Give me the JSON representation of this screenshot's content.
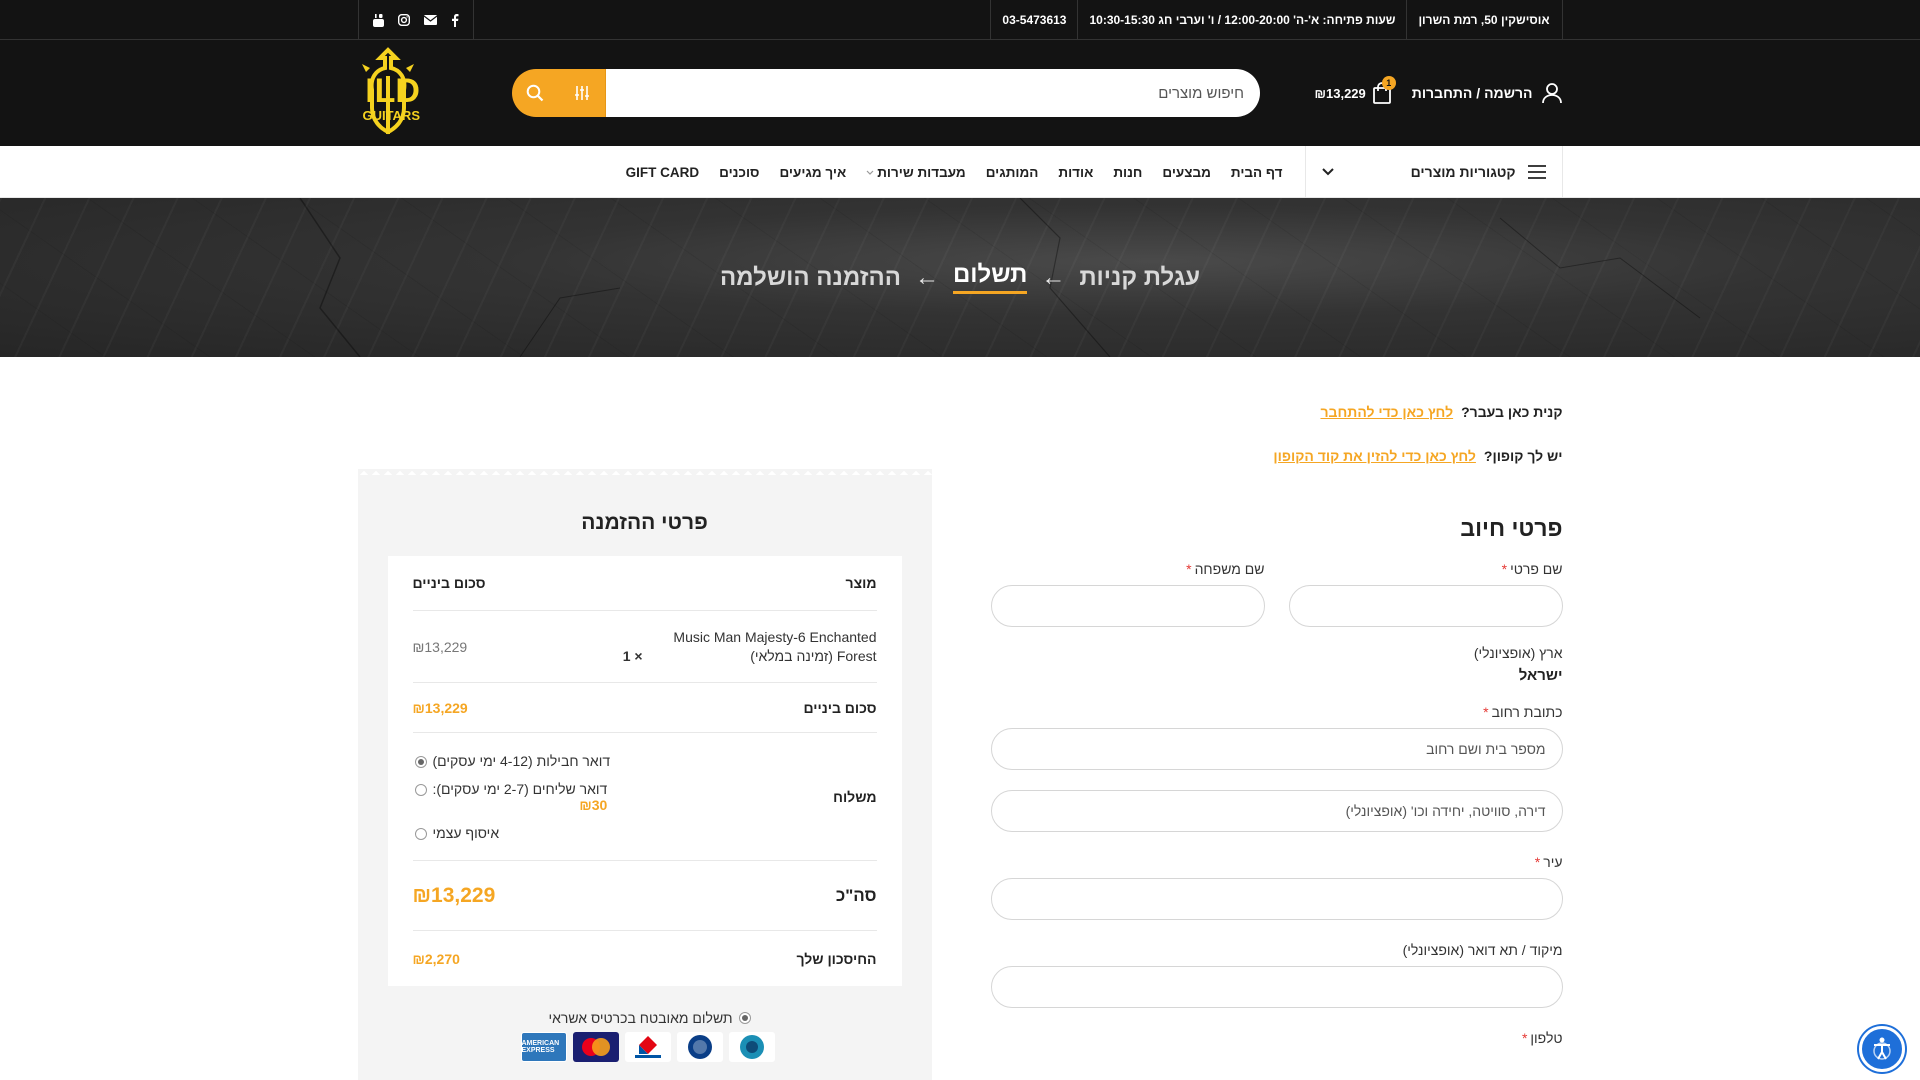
{
  "topbar": {
    "address": "אוסישקין 50, רמת השרון",
    "hours": "שעות פתיחה: א'-ה' 12:00-20:00 / ו' וערבי חג 10:30-15:30",
    "phone": "03-5473613",
    "social": [
      "facebook-icon",
      "envelope-icon",
      "instagram-icon",
      "youtube-icon"
    ]
  },
  "header": {
    "account_label": "הרשמה / התחברות",
    "cart_total": "₪13,229",
    "cart_count": "1",
    "search_placeholder": "חיפוש מוצרים",
    "logo_text_1": "ILD",
    "logo_text_2": "GUITARS"
  },
  "nav": {
    "categories_label": "קטגוריות מוצרים",
    "links": [
      "דף הבית",
      "מבצעים",
      "חנות",
      "אודות",
      "המותגים",
      "מעבדות שירות",
      "איך מגיעים",
      "סוכנים",
      "GIFT CARD"
    ]
  },
  "hero": {
    "steps": [
      "עגלת קניות",
      "תשלום",
      "ההזמנה הושלמה"
    ],
    "arrow": "←"
  },
  "notices": {
    "returning_q": "קנית כאן בעבר?",
    "returning_link": "לחץ כאן כדי להתחבר",
    "coupon_q": "יש לך קופון?",
    "coupon_link": "לחץ כאן כדי להזין את קוד הקופון"
  },
  "billing": {
    "title": "פרטי חיוב",
    "first_name_label": "שם פרטי",
    "last_name_label": "שם משפחה",
    "country_label": "ארץ (אופציונלי)",
    "country_value": "ישראל",
    "street_label": "כתובת רחוב",
    "street_placeholder": "מספר בית ושם רחוב",
    "apt_placeholder": "דירה, סוויטה, יחידה וכו' (אופציונלי)",
    "city_label": "עיר",
    "zip_label": "מיקוד / תא דואר (אופציונלי)",
    "phone_label": "טלפון",
    "required_mark": "*"
  },
  "order": {
    "title": "פרטי ההזמנה",
    "col_product": "מוצר",
    "col_subtotal": "סכום ביניים",
    "product_name": "Music Man Majesty-6 Enchanted Forest (זמינה במלאי)",
    "product_qty": "× 1",
    "product_price": "₪13,229",
    "subtotal_label": "סכום ביניים",
    "subtotal_value": "₪13,229",
    "shipping_label": "משלוח",
    "shipping_options": [
      {
        "label": "דואר חבילות (4-12 ימי עסקים)",
        "price": "",
        "checked": true
      },
      {
        "label": "דואר שליחים (2-7 ימי עסקים):",
        "price": "₪30",
        "checked": false
      },
      {
        "label": "איסוף עצמי",
        "price": "",
        "checked": false
      }
    ],
    "total_label": "סה\"כ",
    "total_value": "₪13,229",
    "savings_label": "החיסכון שלך",
    "savings_value": "₪2,270",
    "payment_label": "תשלום מאובטח בכרטיס אשראי",
    "cards": [
      {
        "name": "AMERICAN EXPRESS",
        "color": "#2e77bb"
      },
      {
        "name": "MasterCard",
        "color": "#1a1f71"
      },
      {
        "name": "ISRACARD",
        "color": "#ffffff"
      },
      {
        "name": "DINERS",
        "color": "#ffffff"
      },
      {
        "name": "CAL",
        "color": "#ffffff"
      }
    ]
  },
  "colors": {
    "accent": "#f5a623",
    "dark": "#131313",
    "summary_bg": "#f4f4f4",
    "required": "#e53935",
    "accessibility": "#1e6fd9"
  }
}
